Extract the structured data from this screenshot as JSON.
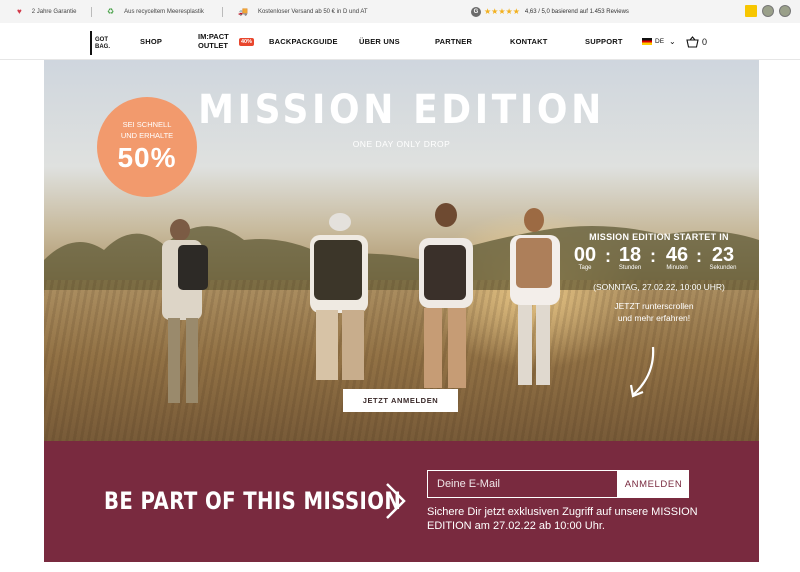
{
  "infobar": {
    "guarantee": "2 Jahre Garantie",
    "recycled": "Aus recyceltem Meeresplastik",
    "shipping": "Kostenloser Versand ab 50 € in D und AT",
    "rating_score": "4,63 / 5,0 basierend auf 1.453 Reviews",
    "rating_stars": 4.63
  },
  "nav": {
    "logo": "GOT BAG.",
    "shop": "SHOP",
    "outlet": "IM:PACT OUTLET",
    "outlet_badge": "40%",
    "backpackguide": "BACKPACKGUIDE",
    "about": "ÜBER UNS",
    "partner": "PARTNER",
    "contact": "KONTAKT",
    "support": "SUPPORT",
    "language": "DE",
    "cart_count": "0"
  },
  "hero": {
    "headline": "MISSION EDITION",
    "subline": "ONE DAY ONLY DROP",
    "sale_line1": "SEI SCHNELL",
    "sale_line2": "UND ERHALTE",
    "sale_value": "50%",
    "countdown_title": "MISSION EDITION STARTET IN",
    "countdown": [
      {
        "value": "00",
        "label": "Tage"
      },
      {
        "value": "18",
        "label": "Stunden"
      },
      {
        "value": "46",
        "label": "Minuten"
      },
      {
        "value": "23",
        "label": "Sekunden"
      }
    ],
    "date_note": "(SONNTAG, 27.02.22, 10:00 UHR)",
    "scroll_note_1": "JETZT runterscrollen",
    "scroll_note_2": "und mehr erfahren!",
    "cta": "JETZT ANMELDEN"
  },
  "newsletter": {
    "title": "BE PART OF THIS MISSION",
    "email_placeholder": "Deine E-Mail",
    "submit": "ANMELDEN",
    "text": "Sichere Dir jetzt exklusiven Zugriff auf unsere MISSION EDITION am 27.02.22 ab 10:00 Uhr."
  },
  "colors": {
    "accent_orange": "#f29a6d",
    "newsletter_bg": "#792a3f",
    "outlet_badge": "#e8462d",
    "star": "#f2b01e"
  }
}
